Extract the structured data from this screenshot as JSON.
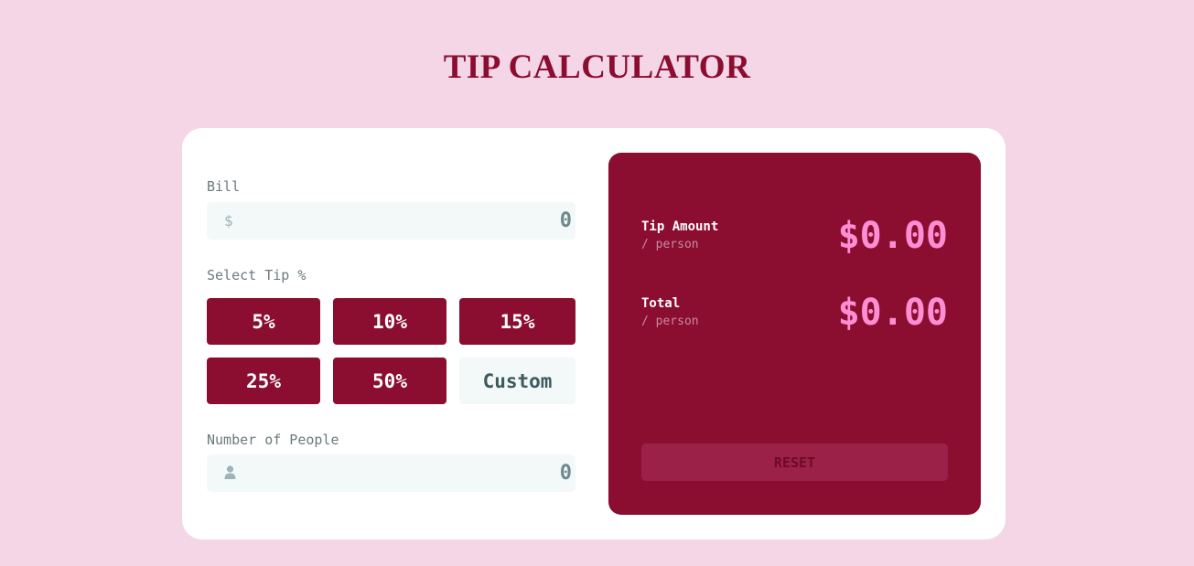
{
  "app": {
    "title": "TIP CALCULATOR"
  },
  "bill": {
    "label": "Bill",
    "icon": "dollar-icon",
    "icon_glyph": "$",
    "value": "0"
  },
  "tip": {
    "label": "Select Tip %",
    "options": [
      "5%",
      "10%",
      "15%",
      "25%",
      "50%"
    ],
    "custom_label": "Custom"
  },
  "people": {
    "label": "Number of People",
    "icon": "person-icon",
    "value": "0"
  },
  "results": {
    "tip_amount": {
      "label": "Tip Amount",
      "sub": "/ person",
      "value": "$0.00"
    },
    "total": {
      "label": "Total",
      "sub": "/ person",
      "value": "$0.00"
    },
    "reset_label": "RESET"
  },
  "colors": {
    "background": "#f5d6e6",
    "accent": "#8b0d30",
    "result_value": "#ff8ed3",
    "input_bg": "#f3f8f9"
  }
}
